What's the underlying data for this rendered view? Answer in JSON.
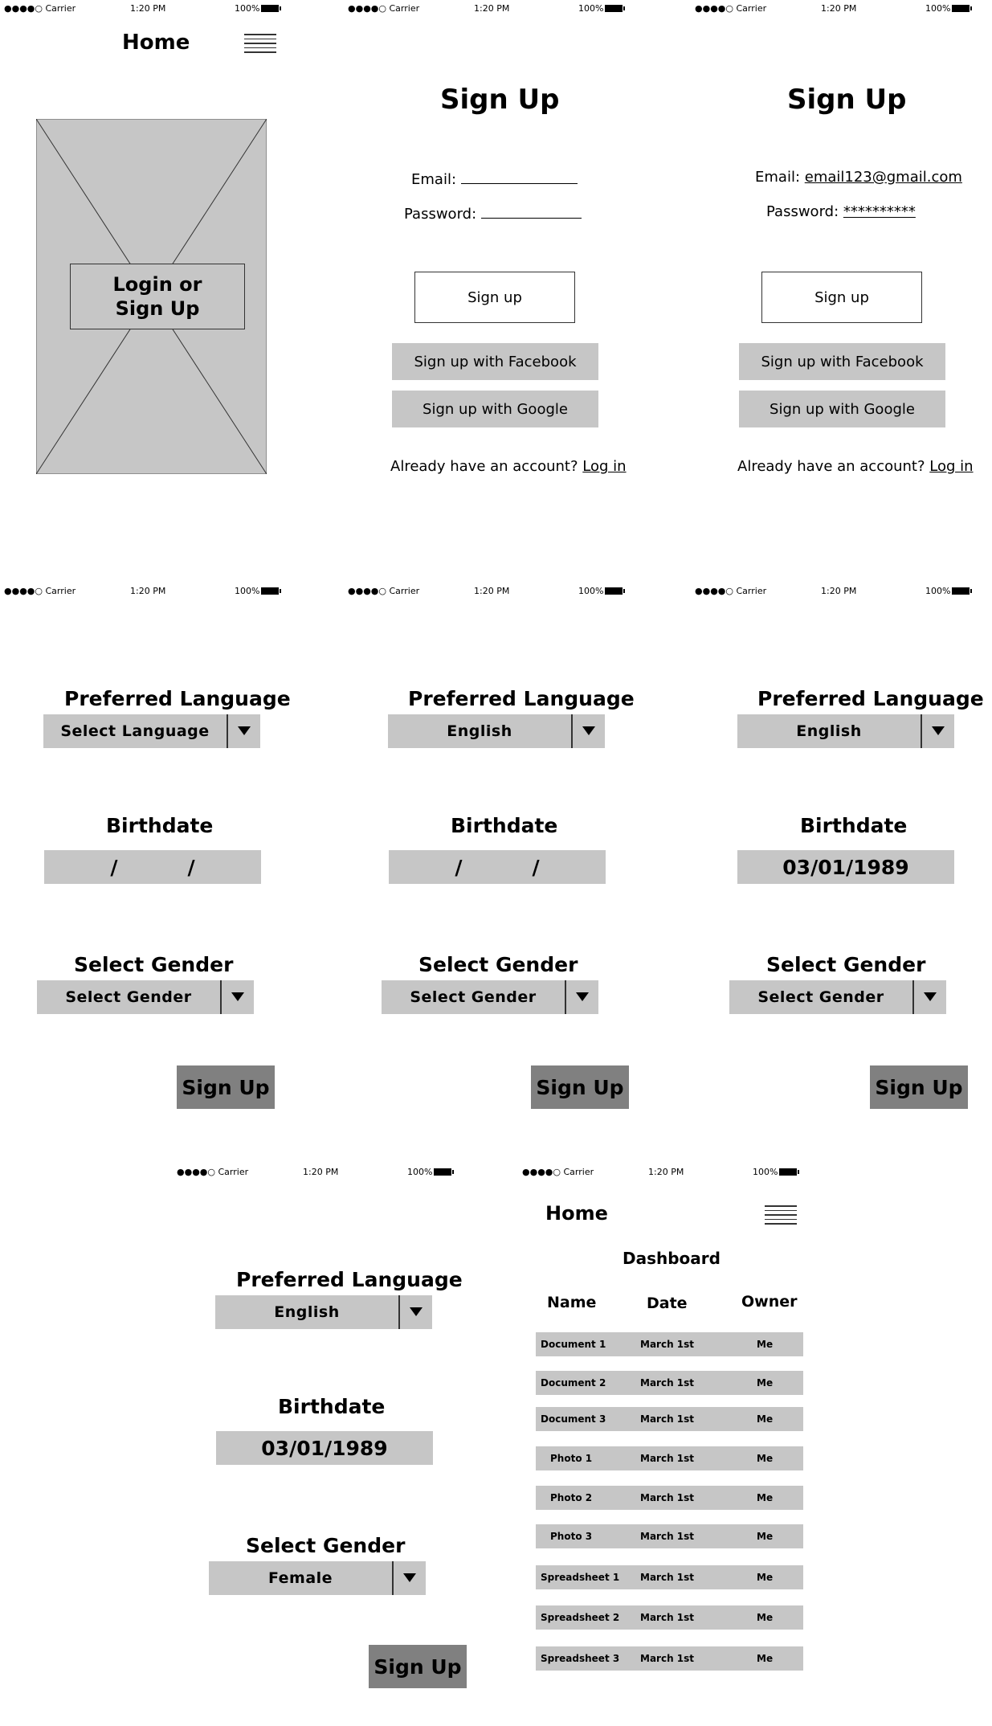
{
  "status_bar": {
    "carrier": "●●●●○ Carrier",
    "time": "1:20 PM",
    "battery": "100%",
    "wifi_icon": "wifi-icon",
    "bluetooth_icon": "bluetooth-icon"
  },
  "screen_home": {
    "title": "Home",
    "placeholder_label": "Login or\nSign Up"
  },
  "signup_screen": {
    "title": "Sign Up",
    "email_label": "Email:",
    "password_label": "Password:",
    "signup_button": "Sign up",
    "facebook_button": "Sign up with Facebook",
    "google_button": "Sign up with Google",
    "already_text": "Already have an account?",
    "login_link": "Log in"
  },
  "signup_filled": {
    "email_value": "email123@gmail.com",
    "password_value": "**********"
  },
  "profile": {
    "language_label": "Preferred Language",
    "birthdate_label": "Birthdate",
    "gender_label": "Select Gender",
    "signup_button": "Sign Up",
    "language_placeholder": "Select Language",
    "language_selected": "English",
    "date_empty": "/          /",
    "date_filled": "03/01/1989",
    "gender_placeholder": "Select Gender",
    "gender_selected": "Female"
  },
  "dashboard": {
    "title": "Home",
    "heading": "Dashboard",
    "columns": [
      "Name",
      "Date",
      "Owner"
    ],
    "rows": [
      {
        "name": "Document 1",
        "date": "March 1st",
        "owner": "Me"
      },
      {
        "name": "Document 2",
        "date": "March 1st",
        "owner": "Me"
      },
      {
        "name": "Document 3",
        "date": "March 1st",
        "owner": "Me"
      },
      {
        "name": "Photo 1",
        "date": "March 1st",
        "owner": "Me"
      },
      {
        "name": "Photo 2",
        "date": "March 1st",
        "owner": "Me"
      },
      {
        "name": "Photo 3",
        "date": "March 1st",
        "owner": "Me"
      },
      {
        "name": "Spreadsheet 1",
        "date": "March 1st",
        "owner": "Me"
      },
      {
        "name": "Spreadsheet 2",
        "date": "March 1st",
        "owner": "Me"
      },
      {
        "name": "Spreadsheet 3",
        "date": "March 1st",
        "owner": "Me"
      }
    ]
  }
}
